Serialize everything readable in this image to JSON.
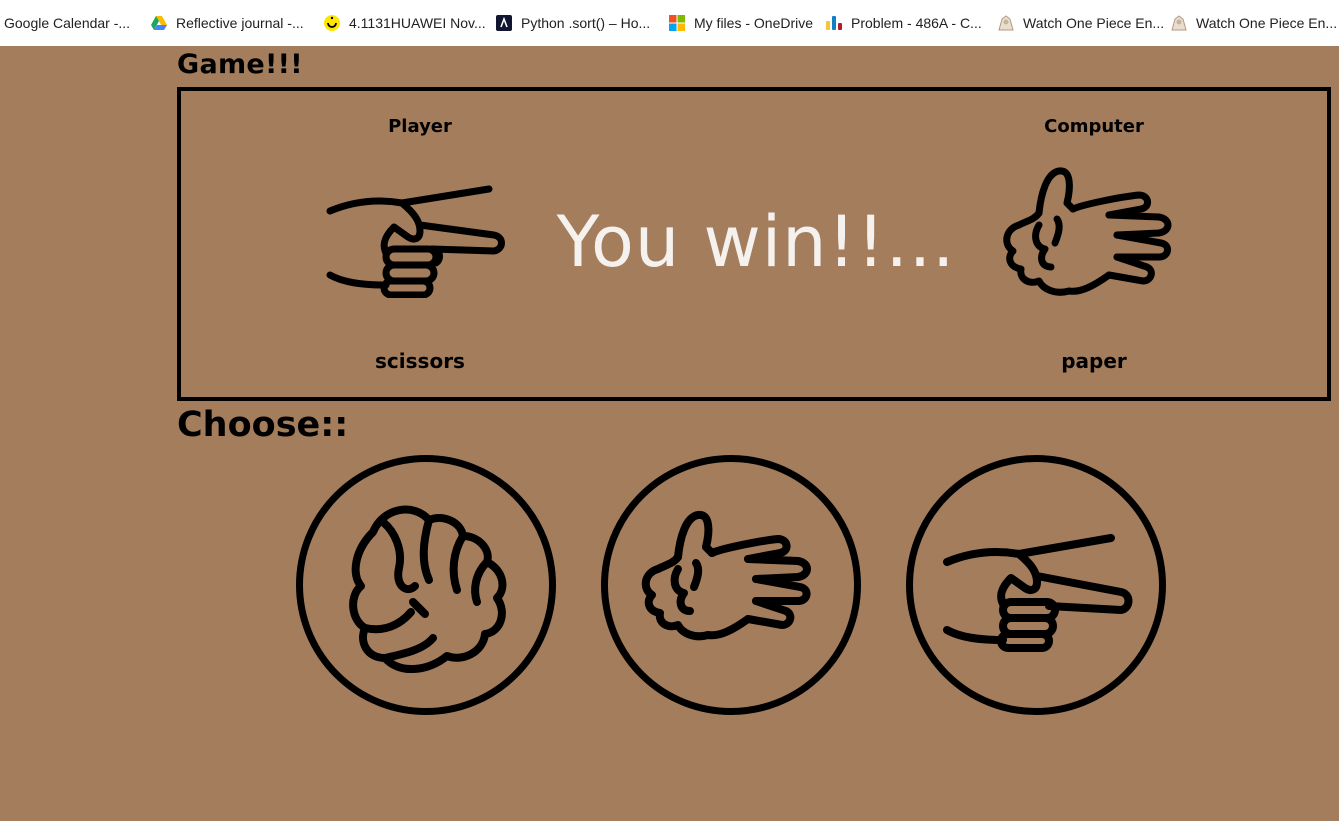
{
  "bookmarks": [
    {
      "label": "Google Calendar -...",
      "icon": "calendar-icon"
    },
    {
      "label": "Reflective journal -...",
      "icon": "google-drive-icon"
    },
    {
      "label": "4.1131HUAWEI Nov...",
      "icon": "smiley-icon"
    },
    {
      "label": "Python .sort() – Ho...",
      "icon": "codecademy-icon"
    },
    {
      "label": "My files - OneDrive",
      "icon": "microsoft-icon"
    },
    {
      "label": "Problem - 486A - C...",
      "icon": "codeforces-icon"
    },
    {
      "label": "Watch One Piece En...",
      "icon": "anime-site-icon"
    },
    {
      "label": "Watch One Piece En...",
      "icon": "anime-site-icon"
    }
  ],
  "game": {
    "title": "Game!!!",
    "player_label": "Player",
    "computer_label": "Computer",
    "result": "You win!!...",
    "player_choice": "scissors",
    "computer_choice": "paper"
  },
  "choose": {
    "title": "Choose::",
    "options": [
      "rock",
      "paper",
      "scissors"
    ]
  },
  "colors": {
    "background": "#a47d5d",
    "result_text": "#f4f1ee",
    "stroke": "#000000"
  }
}
